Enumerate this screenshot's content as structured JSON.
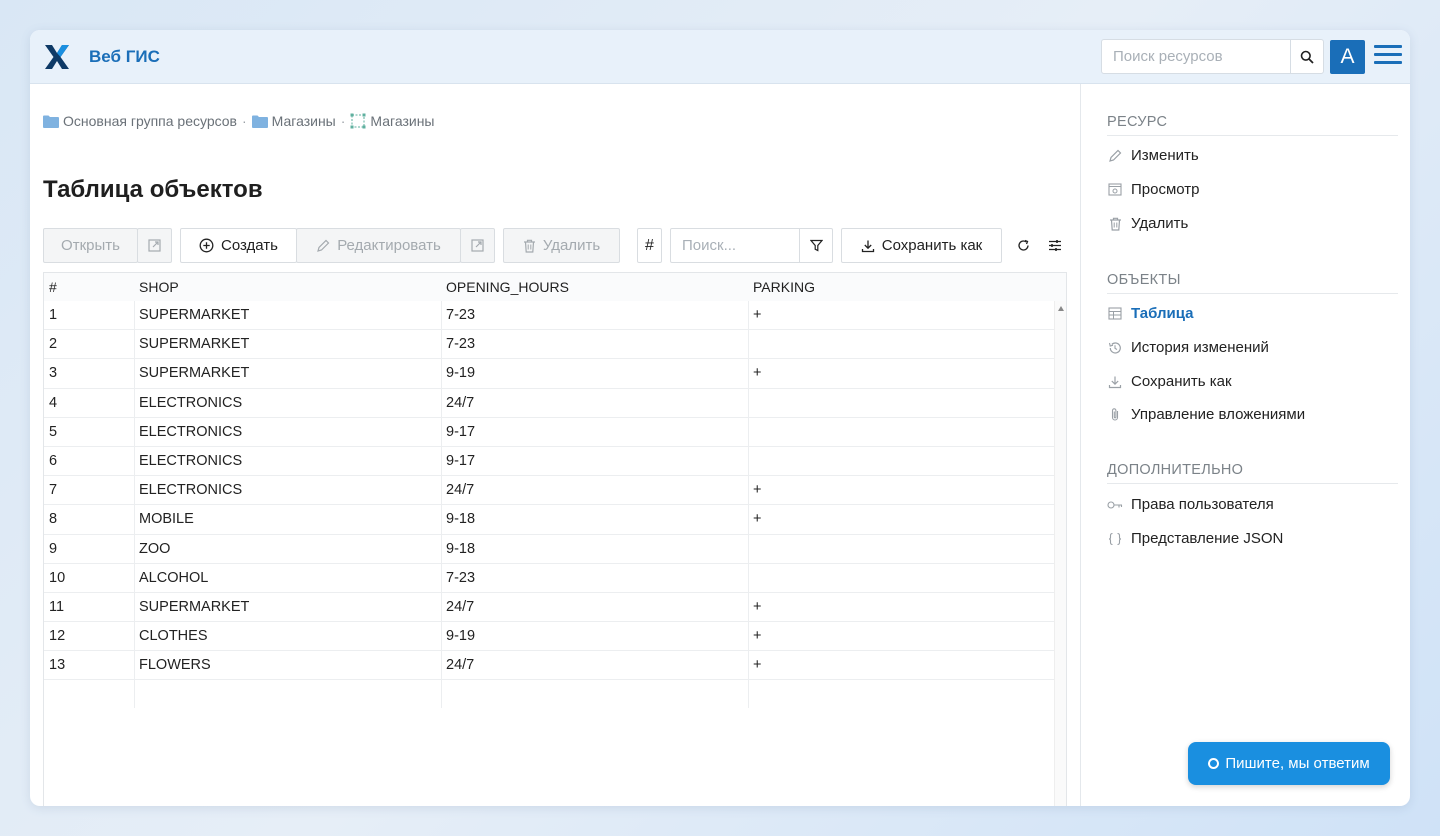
{
  "header": {
    "app_title": "Веб ГИС",
    "search_placeholder": "Поиск ресурсов",
    "avatar_letter": "A"
  },
  "breadcrumb": [
    {
      "label": "Основная группа ресурсов",
      "icon": "folder-icon"
    },
    {
      "label": "Магазины",
      "icon": "folder-icon"
    },
    {
      "label": "Магазины",
      "icon": "vector-layer-icon"
    }
  ],
  "page_title": "Таблица объектов",
  "toolbar": {
    "open_label": "Открыть",
    "create_label": "Создать",
    "edit_label": "Редактировать",
    "delete_label": "Удалить",
    "hash_label": "#",
    "search_placeholder": "Поиск...",
    "save_as_label": "Сохранить как"
  },
  "table": {
    "columns": [
      "#",
      "SHOP",
      "OPENING_HOURS",
      "PARKING"
    ],
    "rows": [
      [
        "1",
        "SUPERMARKET",
        "7-23",
        "+"
      ],
      [
        "2",
        "SUPERMARKET",
        "7-23",
        ""
      ],
      [
        "3",
        "SUPERMARKET",
        "9-19",
        "+"
      ],
      [
        "4",
        "ELECTRONICS",
        "24/7",
        ""
      ],
      [
        "5",
        "ELECTRONICS",
        "9-17",
        ""
      ],
      [
        "6",
        "ELECTRONICS",
        "9-17",
        ""
      ],
      [
        "7",
        "ELECTRONICS",
        "24/7",
        "+"
      ],
      [
        "8",
        "MOBILE",
        "9-18",
        "+"
      ],
      [
        "9",
        "ZOO",
        "9-18",
        ""
      ],
      [
        "10",
        "ALCOHOL",
        "7-23",
        ""
      ],
      [
        "11",
        "SUPERMARKET",
        "24/7",
        "+"
      ],
      [
        "12",
        "CLOTHES",
        "9-19",
        "+"
      ],
      [
        "13",
        "FLOWERS",
        "24/7",
        "+"
      ]
    ]
  },
  "sidebar": {
    "sections": [
      {
        "title": "РЕСУРС",
        "items": [
          {
            "label": "Изменить",
            "icon": "pencil-icon",
            "active": false
          },
          {
            "label": "Просмотр",
            "icon": "preview-icon",
            "active": false
          },
          {
            "label": "Удалить",
            "icon": "trash-icon",
            "active": false
          }
        ]
      },
      {
        "title": "ОБЪЕКТЫ",
        "items": [
          {
            "label": "Таблица",
            "icon": "table-icon",
            "active": true
          },
          {
            "label": "История изменений",
            "icon": "history-icon",
            "active": false
          },
          {
            "label": "Сохранить как",
            "icon": "download-icon",
            "active": false
          },
          {
            "label": "Управление вложениями",
            "icon": "paperclip-icon",
            "active": false
          }
        ]
      },
      {
        "title": "ДОПОЛНИТЕЛЬНО",
        "items": [
          {
            "label": "Права пользователя",
            "icon": "key-icon",
            "active": false
          },
          {
            "label": "Представление JSON",
            "icon": "braces-icon",
            "active": false
          }
        ]
      }
    ]
  },
  "chat": {
    "label": "Пишите, мы ответим"
  },
  "colors": {
    "accent": "#1a6eb8",
    "chat": "#1a8fe0",
    "header_bg": "#e8f1fa"
  }
}
